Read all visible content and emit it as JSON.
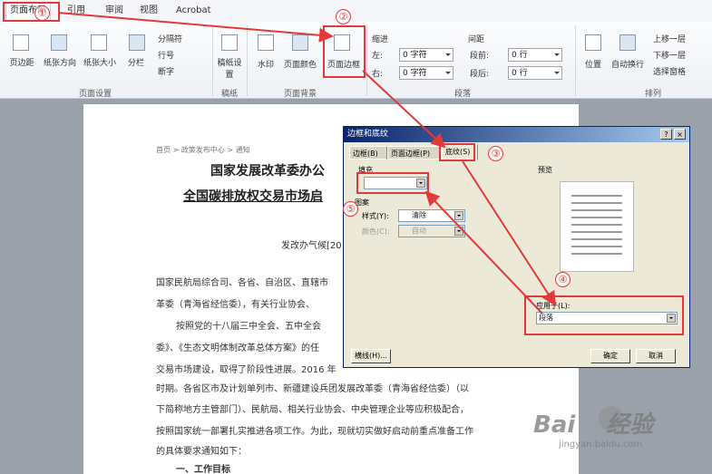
{
  "ribbon": {
    "tabs": [
      "页面布局",
      "引用",
      "审阅",
      "视图",
      "Acrobat"
    ],
    "page_setup": {
      "buttons": [
        "页边距",
        "纸张方向",
        "纸张大小",
        "分栏"
      ],
      "small": [
        "分隔符",
        "行号",
        "断字"
      ],
      "group_label": "页面设置"
    },
    "draft": {
      "button": "稿纸设置",
      "group_label": "稿纸"
    },
    "page_background": {
      "buttons": [
        "水印",
        "页面颜色",
        "页面边框"
      ],
      "group_label": "页面背景"
    },
    "paragraph": {
      "indent_label": "缩进",
      "spacing_label": "间距",
      "left_label": "左:",
      "left_value": "0 字符",
      "right_label": "右:",
      "right_value": "0 字符",
      "before_label": "段前:",
      "before_value": "0 行",
      "after_label": "段后:",
      "after_value": "0 行",
      "group_label": "段落"
    },
    "arrange": {
      "buttons": [
        "位置",
        "自动换行"
      ],
      "small": [
        "上移一层",
        "下移一层",
        "选择窗格"
      ],
      "group_label": "排列"
    }
  },
  "document": {
    "breadcrumb": "首页 > 政策发布中心 > 通知",
    "title1": "国家发展改革委办公",
    "title2": "全国碳排放权交易市场启",
    "doc_number": "发改办气候[20",
    "lines": [
      "国家民航局综合司、各省、自治区、直辖市",
      "革委（青海省经信委），有关行业协会、",
      "按照党的十八届三中全会、五中全会",
      "委》、《生态文明体制改革总体方案》的任",
      "交易市场建设，取得了阶段性进展。2016 年",
      "时期。各省区市及计划单列市、新疆建设兵团发展改革委（青海省经信委）（以",
      "下简称地方主管部门）、民航局、相关行业协会、中央管理企业等应积极配合，",
      "按照国家统一部署扎实推进各项工作。为此，现就切实做好启动前重点准备工作",
      "的具体要求通知如下："
    ],
    "section": "一、工作目标"
  },
  "dialog": {
    "title": "边框和底纹",
    "help": "?",
    "close": "×",
    "tabs": [
      "边框(B)",
      "页面边框(P)",
      "底纹(S)"
    ],
    "fill_label": "填充",
    "pattern_label": "图案",
    "style_label": "样式(Y):",
    "style_value": "清除",
    "color_label": "颜色(C):",
    "color_value": "自动",
    "preview_label": "预览",
    "apply_label": "应用于(L):",
    "apply_value": "段落",
    "lines_button": "横线(H)...",
    "ok_button": "确定",
    "cancel_button": "取消"
  },
  "annotations": {
    "markers": [
      "①",
      "②",
      "③",
      "④",
      "⑤"
    ],
    "color": "#e23a3a"
  },
  "watermark": {
    "brand": "Bai",
    "brand2": "经验",
    "url": "jingyan.baidu.com"
  }
}
